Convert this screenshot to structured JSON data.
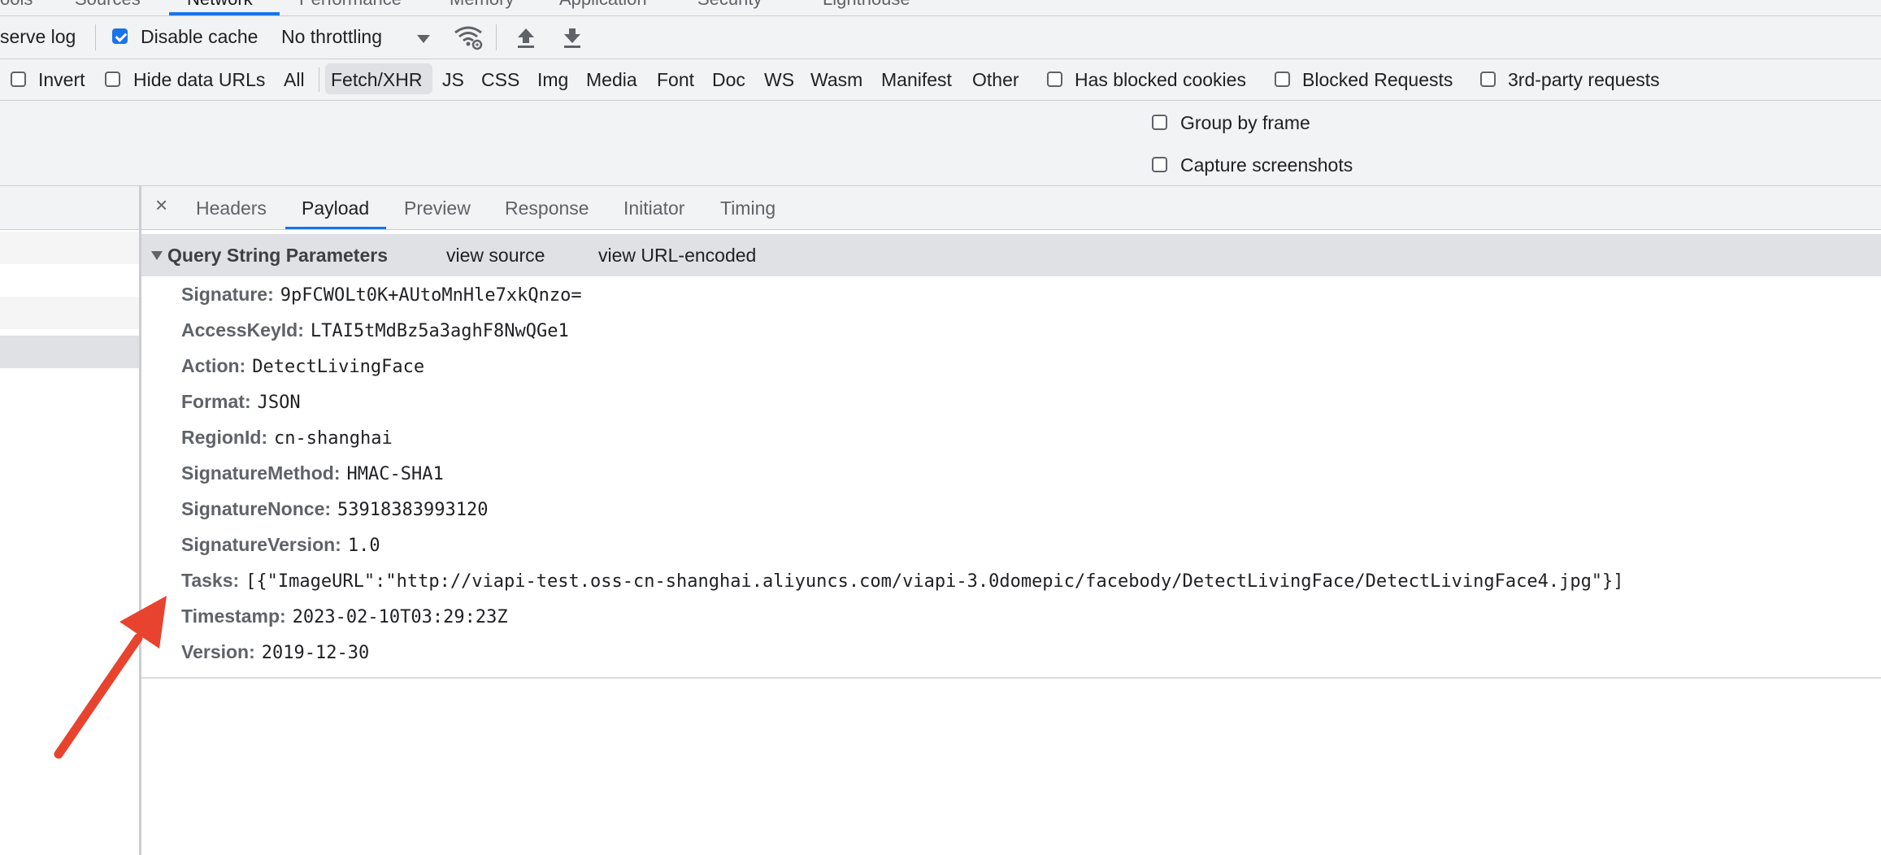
{
  "top_tabs": [
    "ools",
    "Sources",
    "Network",
    "Performance",
    "Memory",
    "Application",
    "Security",
    "Lighthouse"
  ],
  "toolbar": {
    "preserve_log_label": "serve log",
    "disable_cache_label": "Disable cache",
    "disable_cache_checked": true,
    "throttling_value": "No throttling",
    "wifi_icon": "network-conditions-icon",
    "upload_icon": "import-har-icon",
    "download_icon": "export-har-icon"
  },
  "filter": {
    "invert_label": "Invert",
    "hide_data_urls_label": "Hide data URLs",
    "types": [
      "All",
      "Fetch/XHR",
      "JS",
      "CSS",
      "Img",
      "Media",
      "Font",
      "Doc",
      "WS",
      "Wasm",
      "Manifest",
      "Other"
    ],
    "active_type": "Fetch/XHR",
    "has_blocked_cookies_label": "Has blocked cookies",
    "blocked_requests_label": "Blocked Requests",
    "third_party_label": "3rd-party requests"
  },
  "settings": {
    "group_by_frame_label": "Group by frame",
    "capture_screenshots_label": "Capture screenshots"
  },
  "detail_tabs": {
    "close_glyph": "×",
    "tabs": [
      "Headers",
      "Payload",
      "Preview",
      "Response",
      "Initiator",
      "Timing"
    ],
    "active": "Payload"
  },
  "query": {
    "title": "Query String Parameters",
    "view_source": "view source",
    "view_url_encoded": "view URL-encoded",
    "params": [
      {
        "key": "Signature:",
        "value": "9pFCWOLt0K+AUtoMnHle7xkQnzo="
      },
      {
        "key": "AccessKeyId:",
        "value": "LTAI5tMdBz5a3aghF8NwQGe1"
      },
      {
        "key": "Action:",
        "value": "DetectLivingFace"
      },
      {
        "key": "Format:",
        "value": "JSON"
      },
      {
        "key": "RegionId:",
        "value": "cn-shanghai"
      },
      {
        "key": "SignatureMethod:",
        "value": "HMAC-SHA1"
      },
      {
        "key": "SignatureNonce:",
        "value": "53918383993120"
      },
      {
        "key": "SignatureVersion:",
        "value": "1.0"
      },
      {
        "key": "Tasks:",
        "value": "[{\"ImageURL\":\"http://viapi-test.oss-cn-shanghai.aliyuncs.com/viapi-3.0domepic/facebody/DetectLivingFace/DetectLivingFace4.jpg\"}]"
      },
      {
        "key": "Timestamp:",
        "value": "2023-02-10T03:29:23Z"
      },
      {
        "key": "Version:",
        "value": "2019-12-30"
      }
    ]
  },
  "annotation": {
    "arrow_color": "#e8432e"
  }
}
